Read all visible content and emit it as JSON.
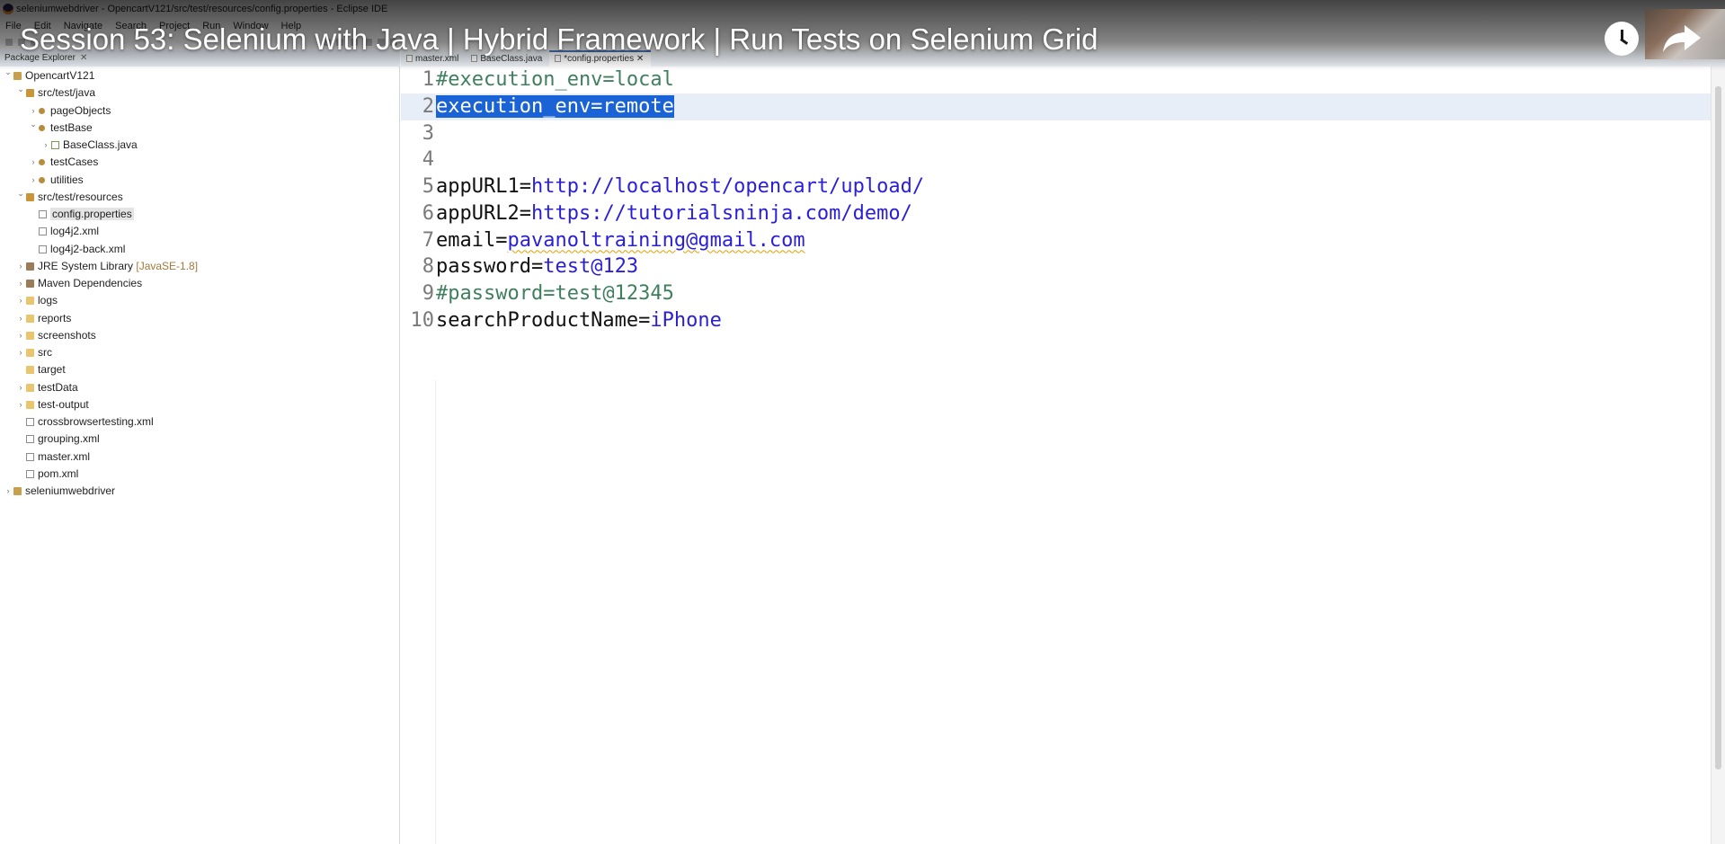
{
  "window": {
    "title": "seleniumwebdriver - OpencartV121/src/test/resources/config.properties - Eclipse IDE"
  },
  "menu": [
    "File",
    "Edit",
    "Navigate",
    "Search",
    "Project",
    "Run",
    "Window",
    "Help"
  ],
  "video": {
    "title": "Session 53: Selenium with Java | Hybrid Framework | Run Tests on Selenium Grid",
    "watch_later_icon": "clock-icon",
    "share_icon": "share-arrow-icon"
  },
  "explorer": {
    "tab_label": "Package Explorer",
    "nodes": [
      {
        "name": "OpencartV121",
        "depth": 0,
        "chevron": "v",
        "icon": "project"
      },
      {
        "name": "src/test/java",
        "depth": 1,
        "chevron": "v",
        "icon": "srcfolder"
      },
      {
        "name": "pageObjects",
        "depth": 2,
        "chevron": ">",
        "icon": "package"
      },
      {
        "name": "testBase",
        "depth": 2,
        "chevron": "v",
        "icon": "package"
      },
      {
        "name": "BaseClass.java",
        "depth": 3,
        "chevron": ">",
        "icon": "java"
      },
      {
        "name": "testCases",
        "depth": 2,
        "chevron": ">",
        "icon": "package"
      },
      {
        "name": "utilities",
        "depth": 2,
        "chevron": ">",
        "icon": "package"
      },
      {
        "name": "src/test/resources",
        "depth": 1,
        "chevron": "v",
        "icon": "srcfolder"
      },
      {
        "name": "config.properties",
        "depth": 2,
        "chevron": "",
        "icon": "file",
        "selected": true
      },
      {
        "name": "log4j2.xml",
        "depth": 2,
        "chevron": "",
        "icon": "file"
      },
      {
        "name": "log4j2-back.xml",
        "depth": 2,
        "chevron": "",
        "icon": "file"
      },
      {
        "name": "JRE System Library",
        "tag": "[JavaSE-1.8]",
        "depth": 1,
        "chevron": ">",
        "icon": "lib"
      },
      {
        "name": "Maven Dependencies",
        "depth": 1,
        "chevron": ">",
        "icon": "lib"
      },
      {
        "name": "logs",
        "depth": 1,
        "chevron": ">",
        "icon": "folder"
      },
      {
        "name": "reports",
        "depth": 1,
        "chevron": ">",
        "icon": "folder"
      },
      {
        "name": "screenshots",
        "depth": 1,
        "chevron": ">",
        "icon": "folder"
      },
      {
        "name": "src",
        "depth": 1,
        "chevron": ">",
        "icon": "folder"
      },
      {
        "name": "target",
        "depth": 1,
        "chevron": "",
        "icon": "folder"
      },
      {
        "name": "testData",
        "depth": 1,
        "chevron": ">",
        "icon": "folder"
      },
      {
        "name": "test-output",
        "depth": 1,
        "chevron": ">",
        "icon": "folder"
      },
      {
        "name": "crossbrowsertesting.xml",
        "depth": 1,
        "chevron": "",
        "icon": "file"
      },
      {
        "name": "grouping.xml",
        "depth": 1,
        "chevron": "",
        "icon": "file"
      },
      {
        "name": "master.xml",
        "depth": 1,
        "chevron": "",
        "icon": "file"
      },
      {
        "name": "pom.xml",
        "depth": 1,
        "chevron": "",
        "icon": "file"
      },
      {
        "name": "seleniumwebdriver",
        "depth": 0,
        "chevron": ">",
        "icon": "project"
      }
    ]
  },
  "editor": {
    "tabs": [
      {
        "label": "master.xml",
        "active": false
      },
      {
        "label": "BaseClass.java",
        "active": false
      },
      {
        "label": "*config.properties",
        "active": true
      }
    ],
    "lines": [
      {
        "num": "1",
        "key": "",
        "value": "",
        "comment": "#execution_env=local"
      },
      {
        "num": "2",
        "selected_text": "execution_env=remote",
        "current": true
      },
      {
        "num": "3"
      },
      {
        "num": "4"
      },
      {
        "num": "5",
        "key": "appURL1=",
        "value": "http://localhost/opencart/upload/"
      },
      {
        "num": "6",
        "key": "appURL2=",
        "value": "https://tutorialsninja.com/demo/"
      },
      {
        "num": "7",
        "key": "email=",
        "value": "pavanoltraining@gmail.com",
        "underline": true
      },
      {
        "num": "8",
        "key": "password=",
        "value": "test@123"
      },
      {
        "num": "9",
        "comment": "#password=test@12345"
      },
      {
        "num": "10",
        "key": "searchProductName=",
        "value": "iPhone"
      }
    ]
  }
}
